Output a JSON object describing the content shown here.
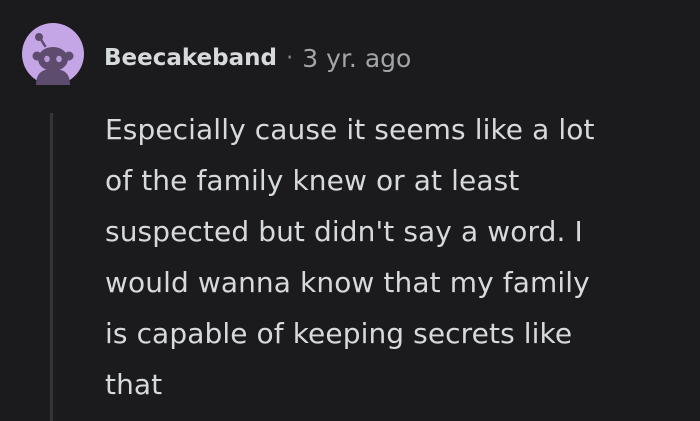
{
  "comment": {
    "username": "Beecakeband",
    "separator": "·",
    "timestamp": "3 yr. ago",
    "avatar_icon": "snoo-avatar-icon",
    "body_lines": [
      "Especially cause it seems like a lot",
      "of the family knew or at least",
      "suspected but didn't say a word. I",
      "would wanna know that my family",
      "is capable of keeping secrets like",
      "that"
    ]
  },
  "colors": {
    "background": "#1b1a1c",
    "text": "#d7dadc",
    "meta": "#a3a6a8",
    "avatar_bg": "#c4a6e6",
    "avatar_figure": "#5e4c6e",
    "thread_line": "#343536"
  }
}
